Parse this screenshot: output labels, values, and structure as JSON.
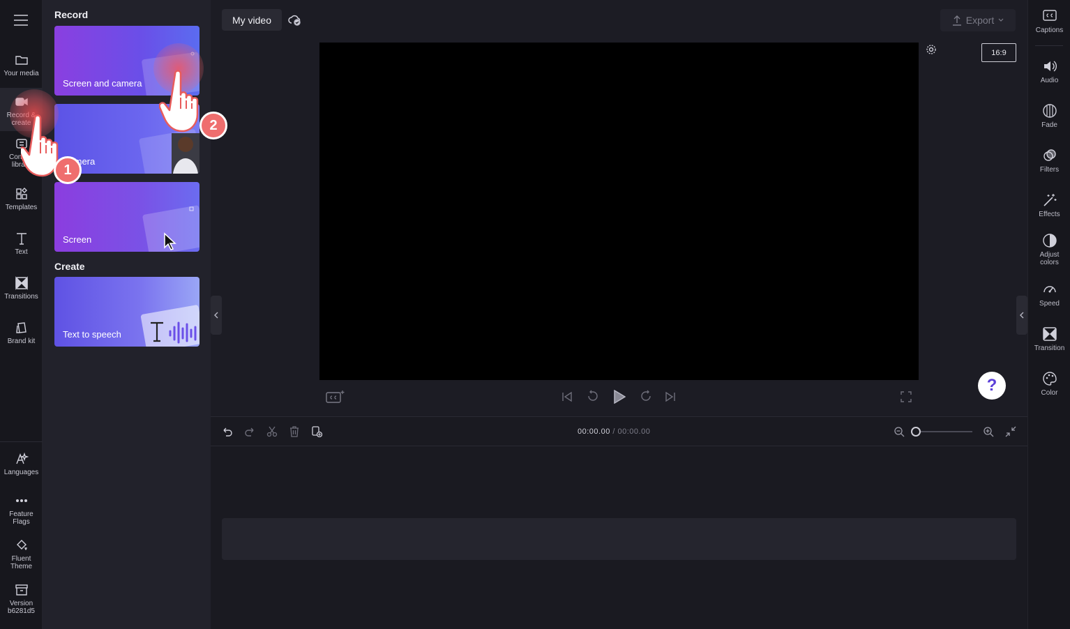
{
  "rail": {
    "items": [
      {
        "label": "Your media"
      },
      {
        "label": "Record &\ncreate"
      },
      {
        "label": "Content\nlibrary"
      },
      {
        "label": "Templates"
      },
      {
        "label": "Text"
      },
      {
        "label": "Transitions"
      },
      {
        "label": "Brand kit"
      }
    ],
    "bottom": [
      {
        "label": "Languages"
      },
      {
        "label": "Feature\nFlags"
      },
      {
        "label": "Fluent\nTheme"
      },
      {
        "label": "Version\nb6281d5"
      }
    ]
  },
  "panel": {
    "record_title": "Record",
    "create_title": "Create",
    "cards": [
      {
        "label": "Screen and camera"
      },
      {
        "label": "Camera"
      },
      {
        "label": "Screen"
      }
    ],
    "create_cards": [
      {
        "label": "Text to speech"
      }
    ]
  },
  "header": {
    "project_title": "My video",
    "export_label": "Export",
    "aspect_ratio": "16:9"
  },
  "timeline": {
    "current_time": "00:00.00",
    "total_time": "/ 00:00.00"
  },
  "help": {
    "label": "?"
  },
  "right_rail": {
    "items": [
      {
        "label": "Captions"
      },
      {
        "label": "Audio"
      },
      {
        "label": "Fade"
      },
      {
        "label": "Filters"
      },
      {
        "label": "Effects"
      },
      {
        "label": "Adjust\ncolors"
      },
      {
        "label": "Speed"
      },
      {
        "label": "Transition"
      },
      {
        "label": "Color"
      }
    ]
  },
  "tutorial": {
    "step1": "1",
    "step2": "2"
  },
  "colors": {
    "accent": "#6a4fe8",
    "step_badge": "#ef6e6e",
    "background": "#1c1c24"
  }
}
